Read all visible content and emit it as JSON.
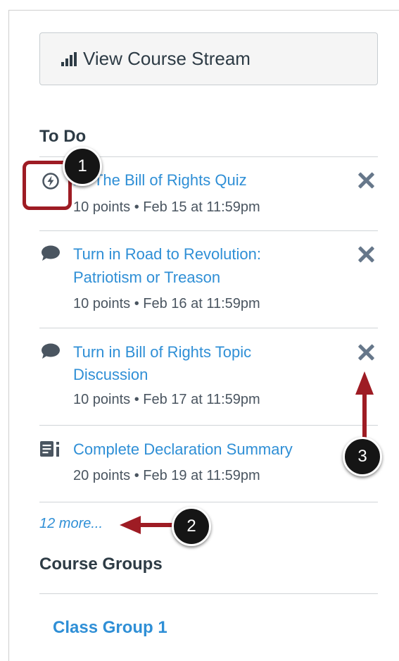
{
  "stream_button": {
    "label": "View Course Stream",
    "icon": "bar-chart-icon"
  },
  "todo": {
    "title": "To Do",
    "items": [
      {
        "icon": "quiz-icon",
        "title": "Take The Bill of Rights Quiz",
        "title_visible": "ke The Bill of Rights Quiz",
        "meta": "10 points • Feb 15 at 11:59pm"
      },
      {
        "icon": "discussion-icon",
        "title_line1": "Turn in Road to Revolution:",
        "title_line2": "Patriotism or Treason",
        "meta": "10 points • Feb 16 at 11:59pm"
      },
      {
        "icon": "discussion-icon",
        "title_line1": "Turn in Bill of Rights Topic",
        "title_line2": "Discussion",
        "meta": "10 points • Feb 17 at 11:59pm"
      },
      {
        "icon": "assignment-icon",
        "title": "Complete Declaration Summary",
        "meta": "20 points • Feb 19 at 11:59pm"
      }
    ],
    "more_link": "12 more..."
  },
  "course_groups": {
    "title": "Course Groups",
    "groups": [
      "Class Group 1"
    ]
  },
  "callouts": {
    "one": "1",
    "two": "2",
    "three": "3"
  },
  "colors": {
    "link": "#2f8fd6",
    "text": "#2d3b45",
    "annotation": "#9e1c24"
  }
}
